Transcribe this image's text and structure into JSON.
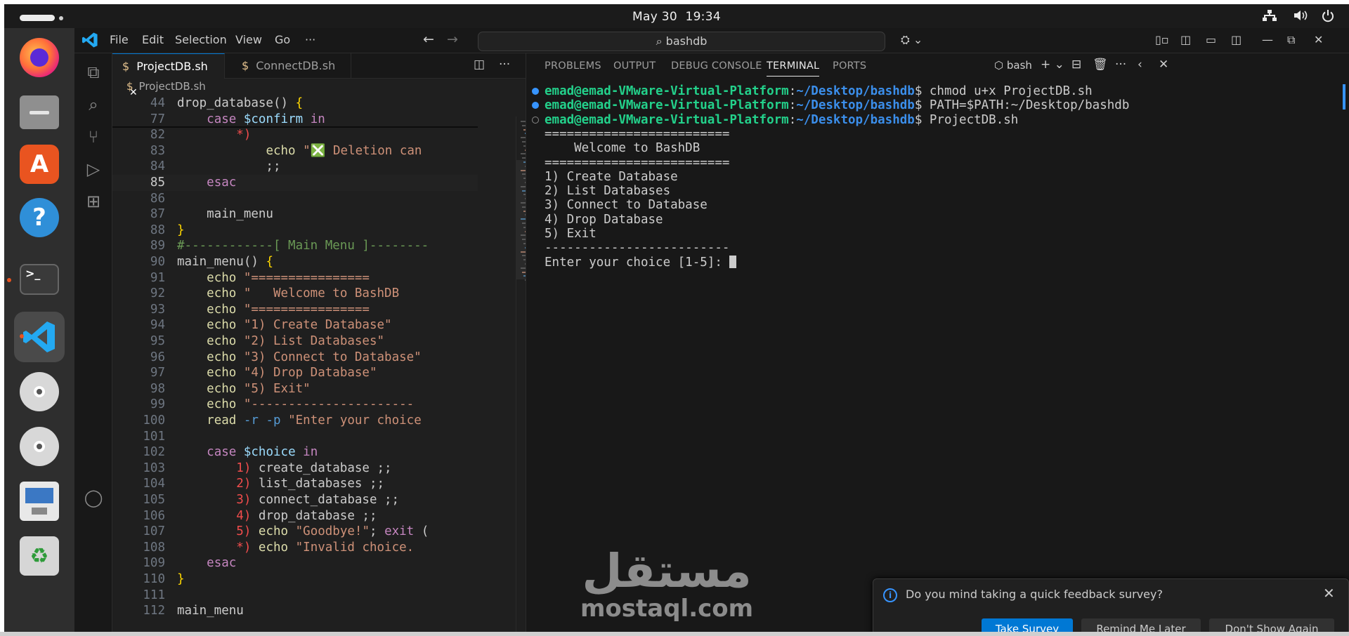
{
  "system": {
    "date": "May 30",
    "time": "19:34"
  },
  "dock": {
    "items": [
      "Firefox",
      "Files",
      "App Center",
      "Help",
      "Terminal",
      "Visual Studio Code",
      "Disc",
      "Disc",
      "Text Editor",
      "Trash"
    ]
  },
  "vscode": {
    "menu": [
      "File",
      "Edit",
      "Selection",
      "View",
      "Go",
      "···"
    ],
    "search_text": "bashdb",
    "tabs": [
      {
        "label": "ProjectDB.sh",
        "active": true,
        "close": "✕"
      },
      {
        "label": "ConnectDB.sh",
        "active": false
      }
    ],
    "breadcrumb": "ProjectDB.sh",
    "code_lines": [
      {
        "n": "44",
        "t": "drop_database() {"
      },
      {
        "n": "77",
        "t": "    case $confirm in"
      },
      {
        "n": "82",
        "t": "        *)"
      },
      {
        "n": "83",
        "t": "            echo \"❎ Deletion can"
      },
      {
        "n": "84",
        "t": "            ;;"
      },
      {
        "n": "85",
        "t": "    esac"
      },
      {
        "n": "86",
        "t": ""
      },
      {
        "n": "87",
        "t": "    main_menu"
      },
      {
        "n": "88",
        "t": "}"
      },
      {
        "n": "89",
        "t": "#------------[ Main Menu ]--------"
      },
      {
        "n": "90",
        "t": "main_menu() {"
      },
      {
        "n": "91",
        "t": "    echo \"================"
      },
      {
        "n": "92",
        "t": "    echo \"   Welcome to BashDB"
      },
      {
        "n": "93",
        "t": "    echo \"================"
      },
      {
        "n": "94",
        "t": "    echo \"1) Create Database\""
      },
      {
        "n": "95",
        "t": "    echo \"2) List Databases\""
      },
      {
        "n": "96",
        "t": "    echo \"3) Connect to Database\""
      },
      {
        "n": "97",
        "t": "    echo \"4) Drop Database\""
      },
      {
        "n": "98",
        "t": "    echo \"5) Exit\""
      },
      {
        "n": "99",
        "t": "    echo \"----------------------"
      },
      {
        "n": "100",
        "t": "    read -r -p \"Enter your choice"
      },
      {
        "n": "101",
        "t": ""
      },
      {
        "n": "102",
        "t": "    case $choice in"
      },
      {
        "n": "103",
        "t": "        1) create_database ;;"
      },
      {
        "n": "104",
        "t": "        2) list_databases ;;"
      },
      {
        "n": "105",
        "t": "        3) connect_database ;;"
      },
      {
        "n": "106",
        "t": "        4) drop_database ;;"
      },
      {
        "n": "107",
        "t": "        5) echo \"Goodbye!\"; exit ("
      },
      {
        "n": "108",
        "t": "        *) echo \"Invalid choice. "
      },
      {
        "n": "109",
        "t": "    esac"
      },
      {
        "n": "110",
        "t": "}"
      },
      {
        "n": "111",
        "t": ""
      },
      {
        "n": "112",
        "t": "main_menu"
      }
    ],
    "panel_tabs": [
      "PROBLEMS",
      "OUTPUT",
      "DEBUG CONSOLE",
      "TERMINAL",
      "PORTS"
    ],
    "terminal_label": "bash",
    "terminal": {
      "prompt_user": "emad@emad-VMware-Virtual-Platform",
      "prompt_path": "~/Desktop/bashdb",
      "commands": [
        "chmod u+x ProjectDB.sh",
        "PATH=$PATH:~/Desktop/bashdb",
        "ProjectDB.sh"
      ],
      "output": [
        "=========================",
        "    Welcome to BashDB",
        "=========================",
        "1) Create Database",
        "2) List Databases",
        "3) Connect to Database",
        "4) Drop Database",
        "5) Exit",
        "-------------------------",
        "Enter your choice [1-5]: "
      ]
    },
    "notification": {
      "message": "Do you mind taking a quick feedback survey?",
      "buttons": [
        "Take Survey",
        "Remind Me Later",
        "Don't Show Again"
      ]
    }
  },
  "watermark": {
    "arabic": "مستقل",
    "latin": "mostaql.com"
  },
  "colors": {
    "accent": "#0078d4",
    "prompt_user": "#23d18b",
    "prompt_path": "#3b8eea",
    "ubuntu_orange": "#e95420"
  }
}
